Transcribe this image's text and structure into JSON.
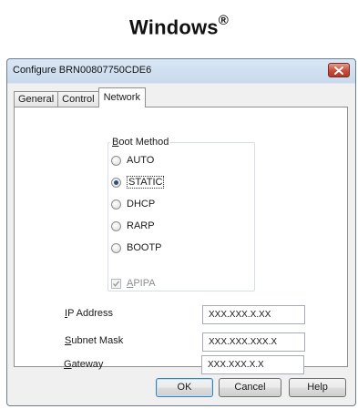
{
  "heading": {
    "text": "Windows",
    "superscript": "®"
  },
  "window": {
    "title": "Configure BRN00807750CDE6",
    "close_icon": "close-x-icon"
  },
  "tabs": [
    {
      "label": "General",
      "active": false
    },
    {
      "label": "Control",
      "active": false
    },
    {
      "label": "Network",
      "active": true
    }
  ],
  "boot_method": {
    "label_accel": "B",
    "label_rest": "oot Method",
    "options": [
      {
        "label": "AUTO",
        "checked": false
      },
      {
        "label": "STATIC",
        "checked": true
      },
      {
        "label": "DHCP",
        "checked": false
      },
      {
        "label": "RARP",
        "checked": false
      },
      {
        "label": "BOOTP",
        "checked": false
      }
    ],
    "apipa": {
      "accel": "A",
      "rest": "PIPA",
      "checked": true,
      "disabled": true
    }
  },
  "fields": [
    {
      "accel": "I",
      "rest": "P Address",
      "value": "XXX.XXX.X.XX"
    },
    {
      "accel": "S",
      "rest": "ubnet Mask",
      "value": "XXX.XXX.XXX.X"
    },
    {
      "accel": "G",
      "rest": "ateway",
      "value": "XXX.XXX.X.X"
    }
  ],
  "buttons": {
    "ok": "OK",
    "cancel": "Cancel",
    "help": "Help"
  },
  "colors": {
    "close_button": "#c94c37",
    "radio_dot": "#2b4f7c",
    "default_button_border": "#3c7fb1"
  }
}
